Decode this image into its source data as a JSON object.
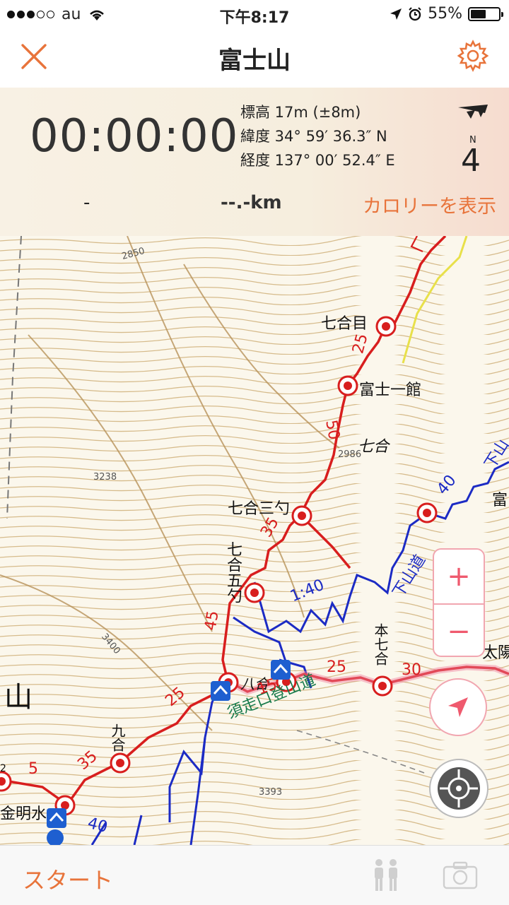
{
  "status_bar": {
    "carrier": "au",
    "time": "下午8:17",
    "battery": "55%",
    "battery_level": 0.55
  },
  "nav": {
    "title": "富士山",
    "close_icon": "close-icon",
    "settings_icon": "gear-icon"
  },
  "info": {
    "timer": "00:00:00",
    "altitude": "標高 17m (±8m)",
    "latitude": "緯度 34° 59′ 36.3″ N",
    "longitude": "経度 137° 00′ 52.4″ E",
    "compass_label": "N",
    "compass_digit": "4",
    "dash": "-",
    "distance": "--.-km",
    "calorie_link": "カロリーを表示"
  },
  "map": {
    "labels": {
      "nanagome": "七合目",
      "fuji_ichikan": "富士一館",
      "nanago": "七合",
      "nanago_sanshaku": "七合三勺",
      "nanago_goshaku": "七合五勺",
      "honnanago": "本七合",
      "kyugo": "九合",
      "hachigo": "八合",
      "subashiri": "須走口登山道",
      "gesandou_right": "下山道",
      "gesandou_top": "下山",
      "fuji_right": "富",
      "taiyo": "太陽",
      "yama": "山",
      "kinmeisui": "金明水",
      "elev_2850": "2850",
      "elev_3238": "3238",
      "elev_2986": "2986",
      "elev_3400": "3400",
      "elev_3393": "3393",
      "n25a": "25",
      "n50": "50",
      "n35a": "35",
      "n45": "45",
      "n25b": "25",
      "n35b": "35",
      "n5": "5",
      "n15": "15",
      "n25c": "25",
      "n30": "30",
      "t140": "1:40",
      "n40a": "40",
      "n40b": "40",
      "n2": "2"
    },
    "zoom_in": "+",
    "zoom_out": "−"
  },
  "toolbar": {
    "start_label": "スタート",
    "people_icon": "hikers-icon",
    "camera_icon": "camera-icon"
  },
  "colors": {
    "accent": "#e8743b",
    "route_red": "#d81e1e",
    "route_blue": "#1c2bc4",
    "map_pink": "#ef5a6e"
  }
}
